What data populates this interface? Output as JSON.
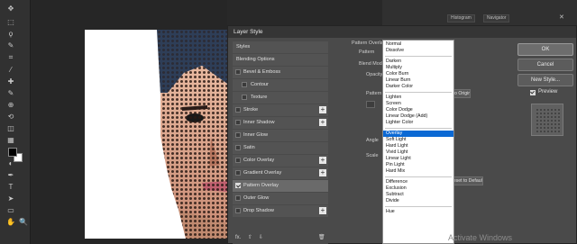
{
  "toolbar": {
    "icons": [
      "move-tool",
      "marquee-tool",
      "lasso-tool",
      "quick-select-tool",
      "crop-tool",
      "eyedropper-tool",
      "healing-tool",
      "brush-tool",
      "stamp-tool",
      "history-brush-tool",
      "eraser-tool",
      "gradient-tool",
      "blur-tool",
      "dodge-tool",
      "pen-tool",
      "type-tool",
      "path-select-tool",
      "shape-tool",
      "hand-tool",
      "zoom-tool"
    ],
    "foreground_color": "#000000",
    "background_color": "#ffffff"
  },
  "dialog": {
    "title": "Layer Style",
    "styles": [
      {
        "label": "Styles",
        "checkbox": false,
        "checked": false,
        "plus": false,
        "indent": false,
        "selected": false
      },
      {
        "label": "Blending Options",
        "checkbox": false,
        "checked": false,
        "plus": false,
        "indent": false,
        "selected": false
      },
      {
        "label": "Bevel & Emboss",
        "checkbox": true,
        "checked": false,
        "plus": false,
        "indent": false,
        "selected": false
      },
      {
        "label": "Contour",
        "checkbox": true,
        "checked": false,
        "plus": false,
        "indent": true,
        "selected": false
      },
      {
        "label": "Texture",
        "checkbox": true,
        "checked": false,
        "plus": false,
        "indent": true,
        "selected": false
      },
      {
        "label": "Stroke",
        "checkbox": true,
        "checked": false,
        "plus": true,
        "indent": false,
        "selected": false
      },
      {
        "label": "Inner Shadow",
        "checkbox": true,
        "checked": false,
        "plus": true,
        "indent": false,
        "selected": false
      },
      {
        "label": "Inner Glow",
        "checkbox": true,
        "checked": false,
        "plus": false,
        "indent": false,
        "selected": false
      },
      {
        "label": "Satin",
        "checkbox": true,
        "checked": false,
        "plus": false,
        "indent": false,
        "selected": false
      },
      {
        "label": "Color Overlay",
        "checkbox": true,
        "checked": false,
        "plus": true,
        "indent": false,
        "selected": false
      },
      {
        "label": "Gradient Overlay",
        "checkbox": true,
        "checked": false,
        "plus": true,
        "indent": false,
        "selected": false
      },
      {
        "label": "Pattern Overlay",
        "checkbox": true,
        "checked": true,
        "plus": false,
        "indent": false,
        "selected": true
      },
      {
        "label": "Outer Glow",
        "checkbox": true,
        "checked": false,
        "plus": false,
        "indent": false,
        "selected": false
      },
      {
        "label": "Drop Shadow",
        "checkbox": true,
        "checked": false,
        "plus": true,
        "indent": false,
        "selected": false
      }
    ],
    "footer": {
      "fx_label": "fx."
    },
    "options": {
      "section_title": "Pattern Overlay",
      "subsection": "Pattern",
      "blend_mode_label": "Blend Mode",
      "opacity_label": "Opacity",
      "pattern_label": "Pattern",
      "snap_button": "Snap to Origin",
      "angle_label": "Angle",
      "scale_label": "Scale",
      "default_button": "Reset to Default"
    },
    "buttons": {
      "ok": "OK",
      "cancel": "Cancel",
      "new_style": "New Style...",
      "preview_label": "Preview"
    }
  },
  "blend_modes": {
    "selected": "Overlay",
    "groups": [
      [
        "Normal",
        "Dissolve"
      ],
      [
        "Darken",
        "Multiply",
        "Color Burn",
        "Linear Burn",
        "Darker Color"
      ],
      [
        "Lighten",
        "Screen",
        "Color Dodge",
        "Linear Dodge (Add)",
        "Lighter Color"
      ],
      [
        "Overlay",
        "Soft Light",
        "Hard Light",
        "Vivid Light",
        "Linear Light",
        "Pin Light",
        "Hard Mix"
      ],
      [
        "Difference",
        "Exclusion",
        "Subtract",
        "Divide"
      ],
      [
        "Hue"
      ]
    ]
  },
  "panels": {
    "tabs": [
      "Histogram",
      "Navigator"
    ]
  },
  "watermark": "Activate Windows"
}
